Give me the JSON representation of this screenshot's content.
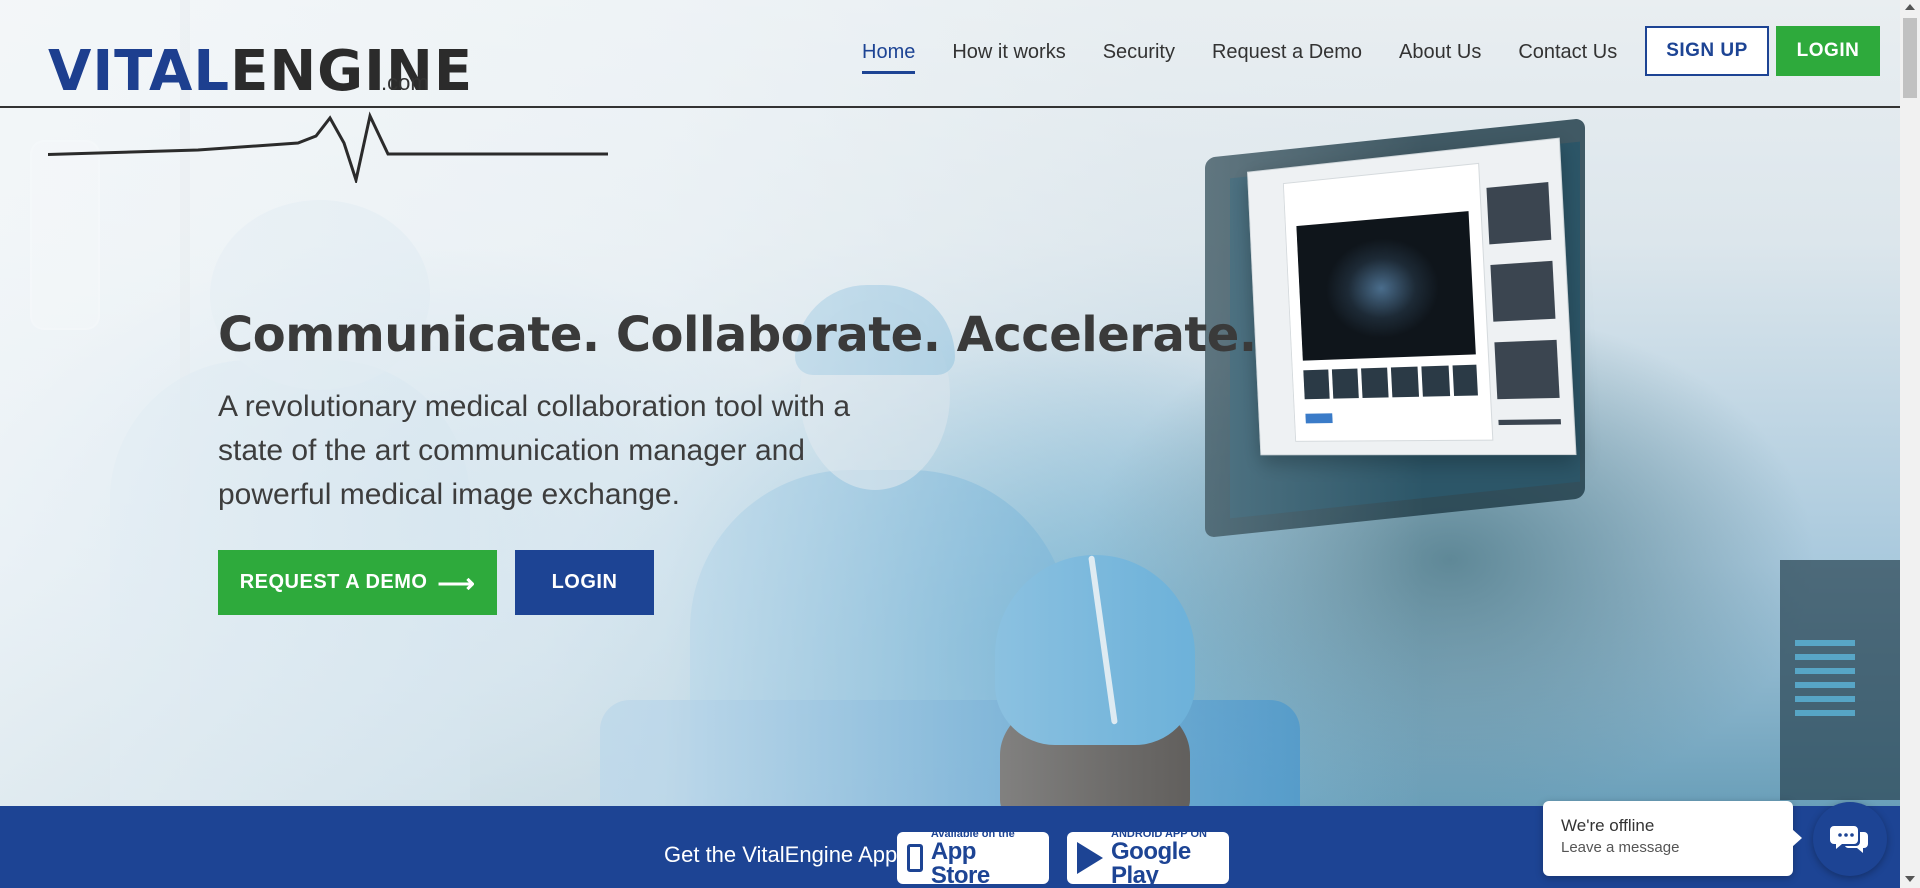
{
  "logo": {
    "brand_vital": "VITAL",
    "brand_engine": "ENGINE",
    "dotcom": ".com"
  },
  "nav": {
    "items": [
      {
        "label": "Home",
        "active": true
      },
      {
        "label": "How it works",
        "active": false
      },
      {
        "label": "Security",
        "active": false
      },
      {
        "label": "Request a Demo",
        "active": false
      },
      {
        "label": "About Us",
        "active": false
      },
      {
        "label": "Contact Us",
        "active": false
      }
    ],
    "signup_label": "SIGN UP",
    "login_label": "LOGIN"
  },
  "hero": {
    "title": "Communicate. Collaborate. Accelerate.",
    "subtitle": "A revolutionary medical collaboration tool with a state of the art communication manager and powerful medical image exchange.",
    "demo_label": "REQUEST A DEMO",
    "demo_arrow": "⟶",
    "login_label": "LOGIN"
  },
  "app_banner": {
    "text": "Get the VitalEngine App",
    "appstore_small": "Available on the",
    "appstore_big": "App Store",
    "google_small": "ANDROID APP ON",
    "google_big": "Google Play"
  },
  "chat": {
    "title": "We're offline",
    "subtitle": "Leave a message"
  },
  "colors": {
    "brand_blue": "#1d4494",
    "brand_green": "#2eaa3c",
    "text_dark": "#333333"
  },
  "icons": {
    "chat": "chat-bubbles-icon",
    "arrow": "arrow-right-icon",
    "apple_phone": "phone-icon",
    "google_play": "play-triangle-icon"
  }
}
